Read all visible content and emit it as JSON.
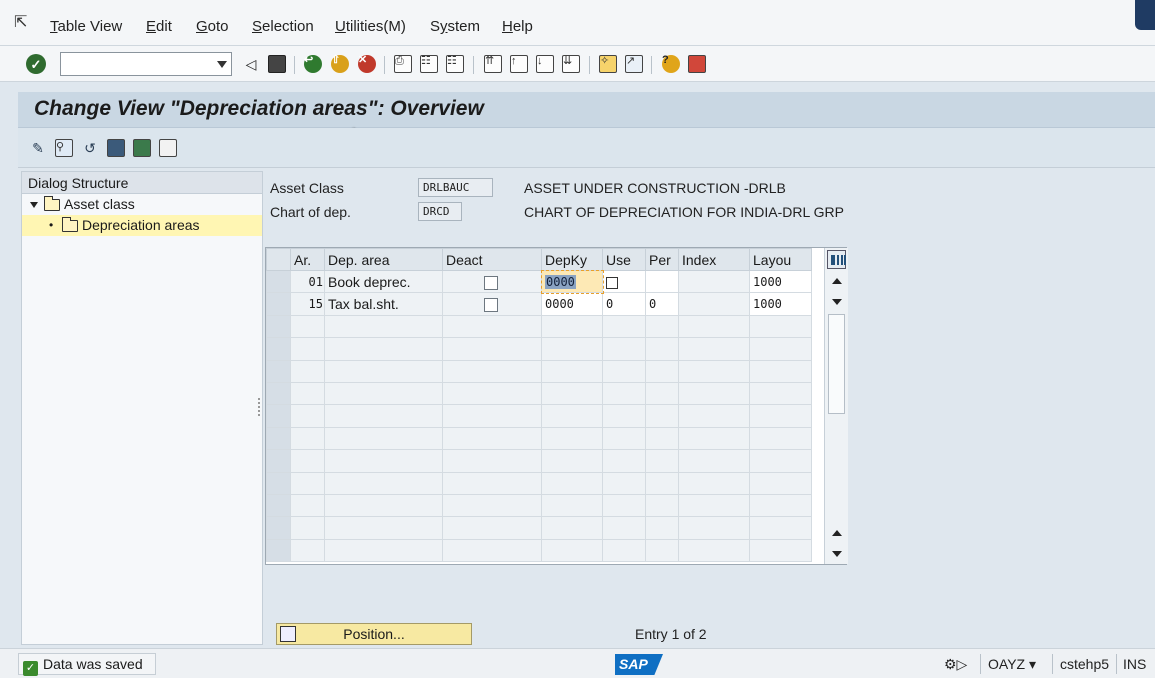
{
  "menu": {
    "items": [
      {
        "label": "Table View",
        "u": "T"
      },
      {
        "label": "Edit",
        "u": "E"
      },
      {
        "label": "Goto",
        "u": "G"
      },
      {
        "label": "Selection",
        "u": "S"
      },
      {
        "label": "Utilities(M)",
        "u": "U"
      },
      {
        "label": "System",
        "u": "y"
      },
      {
        "label": "Help",
        "u": "H"
      }
    ]
  },
  "title": "Change View \"Depreciation areas\": Overview",
  "dialog": {
    "header": "Dialog Structure",
    "items": [
      {
        "label": "Asset class"
      },
      {
        "label": "Depreciation areas"
      }
    ]
  },
  "header_fields": {
    "asset_class_label": "Asset Class",
    "asset_class_value": "DRLBAUC",
    "asset_class_desc": "ASSET UNDER CONSTRUCTION -DRLB",
    "chart_label": "Chart of dep.",
    "chart_value": "DRCD",
    "chart_desc": "CHART OF DEPRECIATION FOR INDIA-DRL GRP"
  },
  "table": {
    "columns": [
      "Ar.",
      "Dep. area",
      "Deact",
      "DepKy",
      "Use",
      "Per",
      "Index",
      "Layou"
    ],
    "rows": [
      {
        "ar": "01",
        "area": "Book deprec.",
        "deky": "0000",
        "use": "",
        "per": "",
        "index": "",
        "layout": "1000"
      },
      {
        "ar": "15",
        "area": "Tax bal.sht.",
        "deky": "0000",
        "use": "0",
        "per": "0",
        "index": "",
        "layout": "1000"
      }
    ]
  },
  "position_button": "Position...",
  "entry_info": "Entry 1 of 2",
  "status": {
    "message": "Data was saved",
    "logo": "SAP",
    "transaction": "OAYZ",
    "server": "cstehp5",
    "mode": "INS"
  }
}
